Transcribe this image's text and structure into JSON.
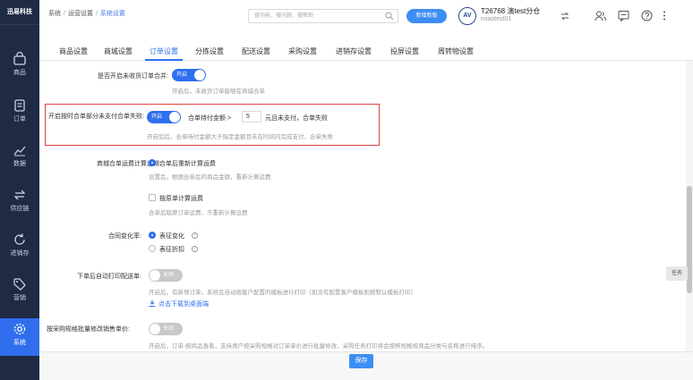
{
  "app": {
    "logo": "迅易科技"
  },
  "sidebar": {
    "items": [
      {
        "label": "商品",
        "icon": "bag-icon"
      },
      {
        "label": "订单",
        "icon": "document-icon"
      },
      {
        "label": "数据",
        "icon": "chart-line-icon"
      },
      {
        "label": "供应链",
        "icon": "swap-arrows-icon"
      },
      {
        "label": "进销存",
        "icon": "cycle-icon"
      },
      {
        "label": "营销",
        "icon": "tag-icon"
      },
      {
        "label": "系统",
        "icon": "gear-icon",
        "active": true
      }
    ]
  },
  "header": {
    "breadcrumb": [
      "系统",
      "运营设置",
      "系统设置"
    ],
    "search_placeholder": "搜功能、搜问题、搜帮助",
    "new_button": "新增新版",
    "avatar_text": "AV",
    "user_name": "T26768 演test分仓",
    "user_sub": "miaotest01"
  },
  "tabs": [
    "商品设置",
    "商城设置",
    "订单设置",
    "分拣设置",
    "配送设置",
    "采购设置",
    "进销存设置",
    "投屏设置",
    "周转物设置"
  ],
  "active_tab": 2,
  "settings": {
    "merge_orders": {
      "label": "是否开启未收货订单合并:",
      "toggle": "开启",
      "hint": "开启后，未收货订单能够在商城合单"
    },
    "merge_fail": {
      "label": "开启按时合单部分未支付合单失败:",
      "toggle": "开启",
      "text1": "合单待付金额 >",
      "amount": "5",
      "text2": "元且未支付，合单失败",
      "hint": "开启后后，合单待付金额大于指定金额且未在时间内完成支付，合单失败"
    },
    "shipping_fee": {
      "label": "商城合单运费计算逻辑:",
      "option1": "合单后重新计算运费",
      "hint1": "设置后，根据合单后的商品金额，重新计算运费",
      "option2": "按原单计算运费",
      "hint2": "合单后取原订单运费，不重新计算运费"
    },
    "discount": {
      "label": "合同变化率:",
      "option1": "表征变化",
      "option2": "表征折扣"
    },
    "auto_print": {
      "label": "下单后自动打印配送单:",
      "toggle": "关闭",
      "hint": "开启后，有新增订单，系统会自动按客户配置的模板进行打印（如没有配置客户模板则按默认模板打印）",
      "link": "点击下载到桌面端"
    },
    "purchase_price": {
      "label": "按采购规格批量修改销售单价:",
      "toggle": "关闭",
      "hint": "开启后，订单-按商品查看，支持用户按采购规格对订单单价进行批量修改，采购任务打印将会按照规格按商品分类与名称进行排序。"
    }
  },
  "task_label": "任务",
  "footer": {
    "save": "保存"
  },
  "colors": {
    "accent": "#2f6fed",
    "sidebar": "#1f2a44",
    "highlight": "#e04040"
  }
}
